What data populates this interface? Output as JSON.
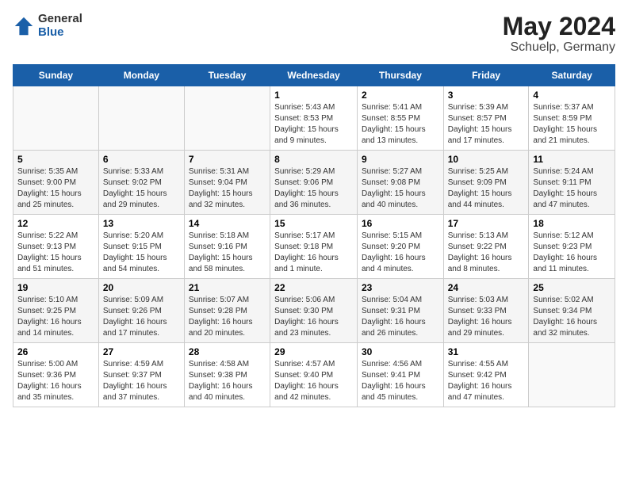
{
  "logo": {
    "general": "General",
    "blue": "Blue"
  },
  "title": "May 2024",
  "subtitle": "Schuelp, Germany",
  "days_of_week": [
    "Sunday",
    "Monday",
    "Tuesday",
    "Wednesday",
    "Thursday",
    "Friday",
    "Saturday"
  ],
  "weeks": [
    [
      {
        "day": "",
        "info": ""
      },
      {
        "day": "",
        "info": ""
      },
      {
        "day": "",
        "info": ""
      },
      {
        "day": "1",
        "info": "Sunrise: 5:43 AM\nSunset: 8:53 PM\nDaylight: 15 hours\nand 9 minutes."
      },
      {
        "day": "2",
        "info": "Sunrise: 5:41 AM\nSunset: 8:55 PM\nDaylight: 15 hours\nand 13 minutes."
      },
      {
        "day": "3",
        "info": "Sunrise: 5:39 AM\nSunset: 8:57 PM\nDaylight: 15 hours\nand 17 minutes."
      },
      {
        "day": "4",
        "info": "Sunrise: 5:37 AM\nSunset: 8:59 PM\nDaylight: 15 hours\nand 21 minutes."
      }
    ],
    [
      {
        "day": "5",
        "info": "Sunrise: 5:35 AM\nSunset: 9:00 PM\nDaylight: 15 hours\nand 25 minutes."
      },
      {
        "day": "6",
        "info": "Sunrise: 5:33 AM\nSunset: 9:02 PM\nDaylight: 15 hours\nand 29 minutes."
      },
      {
        "day": "7",
        "info": "Sunrise: 5:31 AM\nSunset: 9:04 PM\nDaylight: 15 hours\nand 32 minutes."
      },
      {
        "day": "8",
        "info": "Sunrise: 5:29 AM\nSunset: 9:06 PM\nDaylight: 15 hours\nand 36 minutes."
      },
      {
        "day": "9",
        "info": "Sunrise: 5:27 AM\nSunset: 9:08 PM\nDaylight: 15 hours\nand 40 minutes."
      },
      {
        "day": "10",
        "info": "Sunrise: 5:25 AM\nSunset: 9:09 PM\nDaylight: 15 hours\nand 44 minutes."
      },
      {
        "day": "11",
        "info": "Sunrise: 5:24 AM\nSunset: 9:11 PM\nDaylight: 15 hours\nand 47 minutes."
      }
    ],
    [
      {
        "day": "12",
        "info": "Sunrise: 5:22 AM\nSunset: 9:13 PM\nDaylight: 15 hours\nand 51 minutes."
      },
      {
        "day": "13",
        "info": "Sunrise: 5:20 AM\nSunset: 9:15 PM\nDaylight: 15 hours\nand 54 minutes."
      },
      {
        "day": "14",
        "info": "Sunrise: 5:18 AM\nSunset: 9:16 PM\nDaylight: 15 hours\nand 58 minutes."
      },
      {
        "day": "15",
        "info": "Sunrise: 5:17 AM\nSunset: 9:18 PM\nDaylight: 16 hours\nand 1 minute."
      },
      {
        "day": "16",
        "info": "Sunrise: 5:15 AM\nSunset: 9:20 PM\nDaylight: 16 hours\nand 4 minutes."
      },
      {
        "day": "17",
        "info": "Sunrise: 5:13 AM\nSunset: 9:22 PM\nDaylight: 16 hours\nand 8 minutes."
      },
      {
        "day": "18",
        "info": "Sunrise: 5:12 AM\nSunset: 9:23 PM\nDaylight: 16 hours\nand 11 minutes."
      }
    ],
    [
      {
        "day": "19",
        "info": "Sunrise: 5:10 AM\nSunset: 9:25 PM\nDaylight: 16 hours\nand 14 minutes."
      },
      {
        "day": "20",
        "info": "Sunrise: 5:09 AM\nSunset: 9:26 PM\nDaylight: 16 hours\nand 17 minutes."
      },
      {
        "day": "21",
        "info": "Sunrise: 5:07 AM\nSunset: 9:28 PM\nDaylight: 16 hours\nand 20 minutes."
      },
      {
        "day": "22",
        "info": "Sunrise: 5:06 AM\nSunset: 9:30 PM\nDaylight: 16 hours\nand 23 minutes."
      },
      {
        "day": "23",
        "info": "Sunrise: 5:04 AM\nSunset: 9:31 PM\nDaylight: 16 hours\nand 26 minutes."
      },
      {
        "day": "24",
        "info": "Sunrise: 5:03 AM\nSunset: 9:33 PM\nDaylight: 16 hours\nand 29 minutes."
      },
      {
        "day": "25",
        "info": "Sunrise: 5:02 AM\nSunset: 9:34 PM\nDaylight: 16 hours\nand 32 minutes."
      }
    ],
    [
      {
        "day": "26",
        "info": "Sunrise: 5:00 AM\nSunset: 9:36 PM\nDaylight: 16 hours\nand 35 minutes."
      },
      {
        "day": "27",
        "info": "Sunrise: 4:59 AM\nSunset: 9:37 PM\nDaylight: 16 hours\nand 37 minutes."
      },
      {
        "day": "28",
        "info": "Sunrise: 4:58 AM\nSunset: 9:38 PM\nDaylight: 16 hours\nand 40 minutes."
      },
      {
        "day": "29",
        "info": "Sunrise: 4:57 AM\nSunset: 9:40 PM\nDaylight: 16 hours\nand 42 minutes."
      },
      {
        "day": "30",
        "info": "Sunrise: 4:56 AM\nSunset: 9:41 PM\nDaylight: 16 hours\nand 45 minutes."
      },
      {
        "day": "31",
        "info": "Sunrise: 4:55 AM\nSunset: 9:42 PM\nDaylight: 16 hours\nand 47 minutes."
      },
      {
        "day": "",
        "info": ""
      }
    ]
  ]
}
